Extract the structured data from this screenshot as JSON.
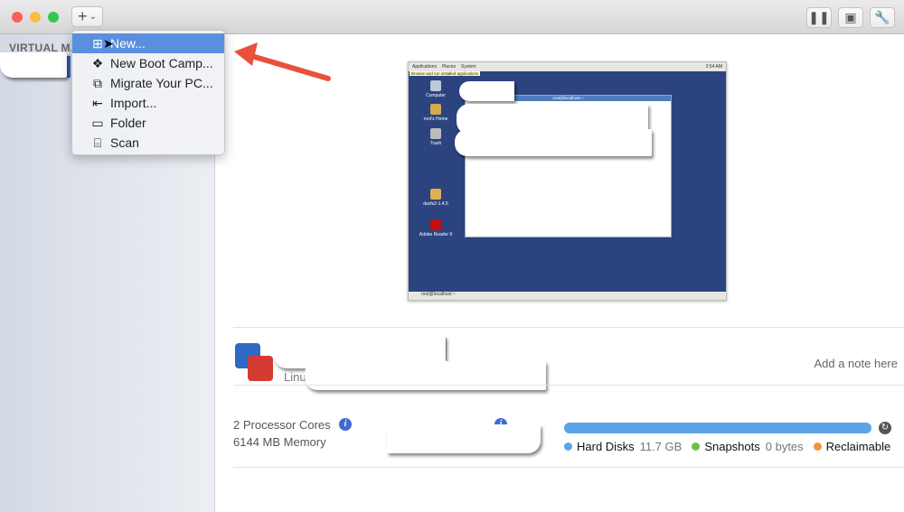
{
  "toolbar": {
    "add_label": "+",
    "add_chevron": "⌄"
  },
  "sidebar": {
    "header": "VIRTUAL MACHINES"
  },
  "menu": {
    "items": [
      {
        "label": "New...",
        "icon": "plus-square-icon",
        "glyph": "⊞"
      },
      {
        "label": "New Boot Camp...",
        "icon": "boot-camp-icon",
        "glyph": "❖"
      },
      {
        "label": "Migrate Your PC...",
        "icon": "migrate-icon",
        "glyph": "⧉"
      },
      {
        "label": "Import...",
        "icon": "import-icon",
        "glyph": "⇤"
      },
      {
        "label": "Folder",
        "icon": "folder-icon",
        "glyph": "▭"
      },
      {
        "label": "Scan",
        "icon": "scan-icon",
        "glyph": "⌸"
      }
    ]
  },
  "guest": {
    "menus": [
      "Applications",
      "Places",
      "System"
    ],
    "tooltip": "Browse and run installed applications",
    "clock": "2:54 AM",
    "window_title": "root@localhost:~",
    "taskbar_item": "root@localhost:~",
    "icons": [
      "Computer",
      "root's Home",
      "Trash",
      "davfs2-1.4.5",
      "Adobe Reader 9"
    ]
  },
  "vm": {
    "os_partial": "Linu",
    "note_placeholder": "Add a note here",
    "cpu": "2 Processor Cores",
    "memory": "6144 MB Memory"
  },
  "storage": {
    "fill_percent": 100,
    "legend": [
      {
        "label": "Hard Disks",
        "value": "11.7 GB",
        "color": "#5aa5e8"
      },
      {
        "label": "Snapshots",
        "value": "0 bytes",
        "color": "#6cc04a"
      },
      {
        "label": "Reclaimable",
        "value": "",
        "color": "#f0953a"
      }
    ]
  },
  "colors": {
    "accent": "#5a8fe0",
    "arrow": "#e8513e"
  }
}
